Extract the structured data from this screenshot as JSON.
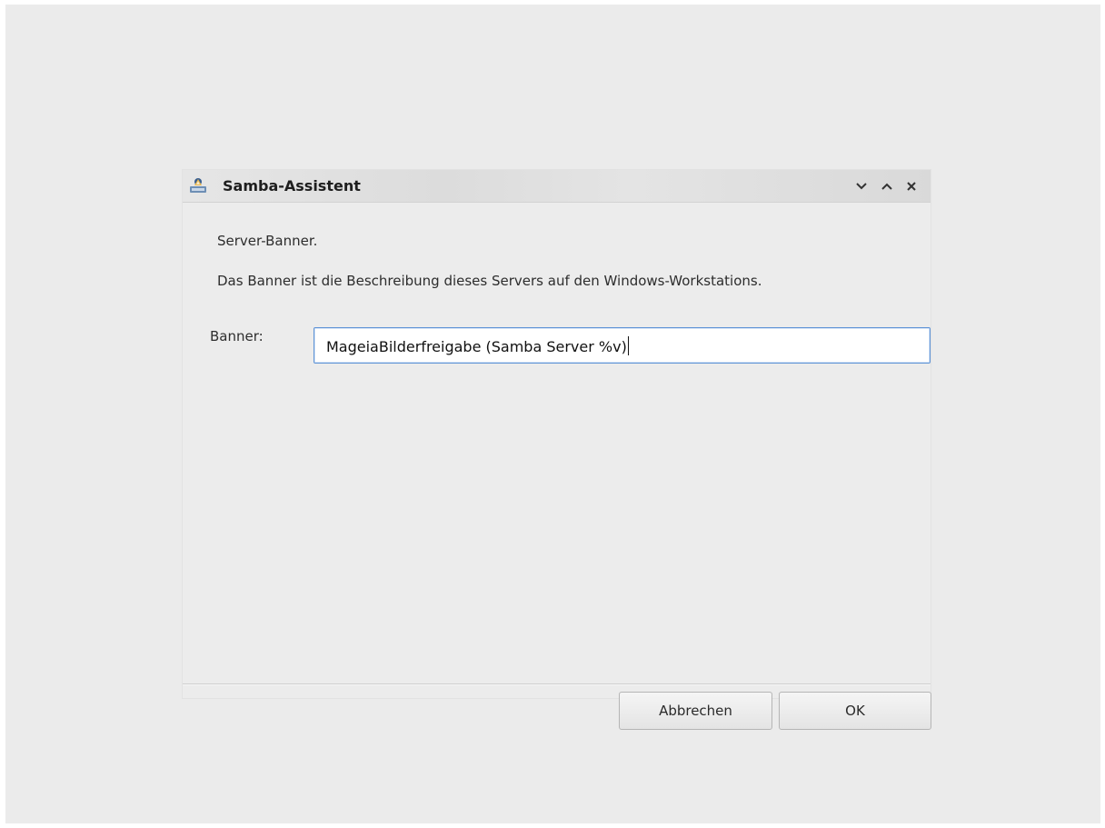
{
  "window": {
    "title": "Samba-Assistent",
    "icon": "samba-app-icon",
    "controls": [
      "minimize-icon",
      "maximize-icon",
      "close-icon"
    ]
  },
  "content": {
    "heading": "Server-Banner.",
    "description": "Das Banner ist die Beschreibung dieses Servers auf den Windows-Workstations.",
    "field_label": "Banner:",
    "field_value": "MageiaBilderfreigabe (Samba Server %v)"
  },
  "buttons": {
    "cancel_label": "Abbrechen",
    "ok_label": "OK"
  },
  "colors": {
    "focus_border": "#5e93d6",
    "background": "#ececec"
  }
}
